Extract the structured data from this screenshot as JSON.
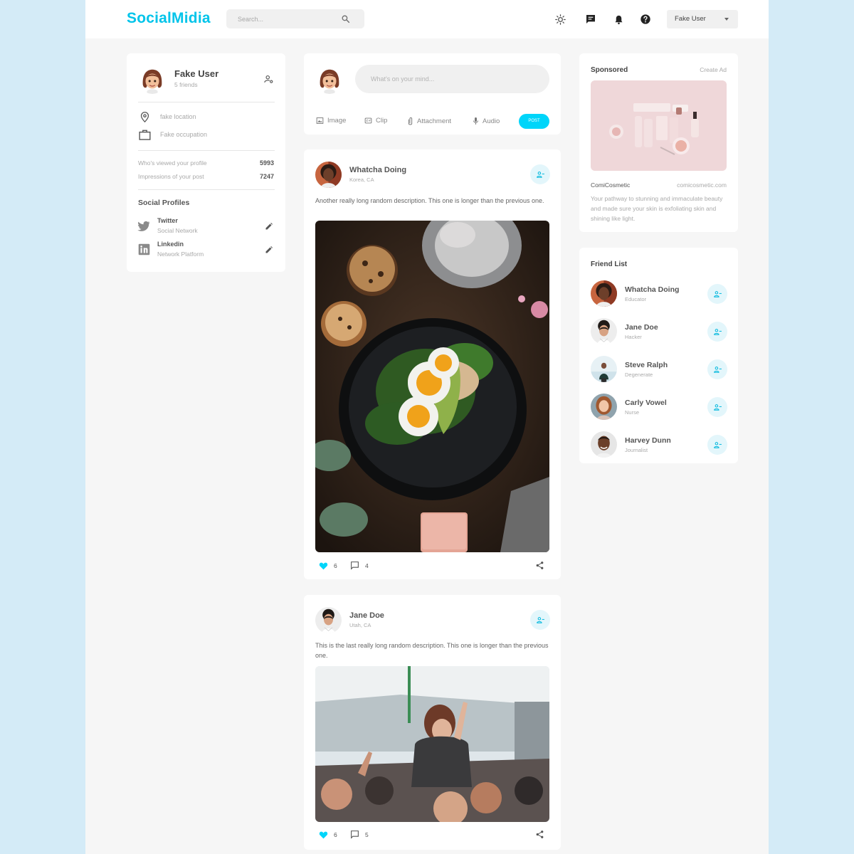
{
  "app": {
    "name": "SocialMidia"
  },
  "search": {
    "placeholder": "Search..."
  },
  "navbar": {
    "user_name": "Fake User"
  },
  "colors": {
    "accent": "#00c4ea",
    "accent_button": "#00d5fa",
    "liked": "#00d5fa",
    "frame_background": "#d4ebf7",
    "page_background": "#f6f6f6"
  },
  "icons": {
    "search": "search-icon",
    "theme": "sun-icon",
    "messages": "message-icon",
    "notifications": "bell-icon",
    "help": "help-icon",
    "location": "location-pin-icon",
    "occupation": "briefcase-icon",
    "twitter": "twitter-icon",
    "linkedin": "linkedin-icon",
    "edit": "pencil-icon",
    "manage": "manage-accounts-icon",
    "add_friend": "person-add-icon",
    "like": "heart-icon",
    "comment": "comment-icon",
    "share": "share-icon"
  },
  "profile": {
    "name": "Fake User",
    "friends": "5 friends",
    "location": "fake location",
    "occupation": "Fake occupation",
    "stats": [
      {
        "label": "Who's viewed your profile",
        "value": "5993"
      },
      {
        "label": "Impressions of your post",
        "value": "7247"
      }
    ],
    "social_title": "Social Profiles",
    "socials": [
      {
        "name": "Twitter",
        "sub": "Social Network"
      },
      {
        "name": "Linkedin",
        "sub": "Network Platform"
      }
    ]
  },
  "composer": {
    "placeholder": "What's on your mind...",
    "tools": [
      "Image",
      "Clip",
      "Attachment",
      "Audio"
    ],
    "post_label": "POST"
  },
  "posts": [
    {
      "name": "Whatcha Doing",
      "location": "Korea, CA",
      "description": "Another really long random description. This one is longer than the previous one.",
      "likes": "6",
      "comments": "4",
      "liked": true
    },
    {
      "name": "Jane Doe",
      "location": "Utah, CA",
      "description": "This is the last really long random description. This one is longer than the previous one.",
      "likes": "6",
      "comments": "5",
      "liked": true
    }
  ],
  "sponsored": {
    "title": "Sponsored",
    "create_ad": "Create Ad",
    "brand": "ComiCosmetic",
    "url": "comicosmetic.com",
    "description": "Your pathway to stunning and immaculate beauty and made sure your skin is exfoliating skin and shining like light."
  },
  "friends": {
    "title": "Friend List",
    "items": [
      {
        "name": "Whatcha Doing",
        "role": "Educator"
      },
      {
        "name": "Jane Doe",
        "role": "Hacker"
      },
      {
        "name": "Steve Ralph",
        "role": "Degenerate"
      },
      {
        "name": "Carly Vowel",
        "role": "Nurse"
      },
      {
        "name": "Harvey Dunn",
        "role": "Journalist"
      }
    ]
  }
}
